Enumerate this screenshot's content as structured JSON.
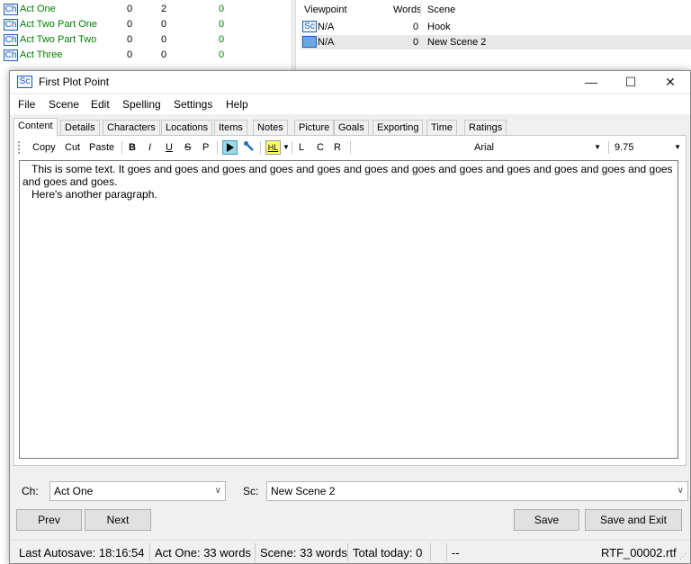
{
  "background": {
    "chapters": [
      {
        "badge": "Ch",
        "name": "Act One",
        "c1": "0",
        "c2": "2",
        "c3": "0"
      },
      {
        "badge": "Ch",
        "name": "Act Two Part One",
        "c1": "0",
        "c2": "0",
        "c3": "0"
      },
      {
        "badge": "Ch",
        "name": "Act Two Part Two",
        "c1": "0",
        "c2": "0",
        "c3": "0"
      },
      {
        "badge": "Ch",
        "name": "Act Three",
        "c1": "0",
        "c2": "0",
        "c3": "0"
      }
    ],
    "scenes_header": {
      "viewpoint": "Viewpoint",
      "words": "Words",
      "scene": "Scene"
    },
    "scenes": [
      {
        "badge": "Sc",
        "viewpoint": "N/A",
        "words": "0",
        "scene": "Hook"
      },
      {
        "badge": "",
        "viewpoint": "N/A",
        "words": "0",
        "scene": "New Scene 2"
      }
    ]
  },
  "dialog": {
    "icon": "Sc",
    "title": "First Plot Point",
    "window_buttons": {
      "minimize": "—",
      "maximize": "☐",
      "close": "✕"
    },
    "menu": [
      "File",
      "Scene",
      "Edit",
      "Spelling",
      "Settings",
      "Help"
    ],
    "tabs": [
      "Content",
      "Details",
      "Characters",
      "Locations",
      "Items",
      "Notes",
      "Picture",
      "Goals",
      "Exporting",
      "Time",
      "Ratings"
    ],
    "active_tab": "Content",
    "toolbar": {
      "copy": "Copy",
      "cut": "Cut",
      "paste": "Paste",
      "bold": "B",
      "italic": "I",
      "underline": "U",
      "strike": "S",
      "para": "P",
      "highlight": "HL",
      "left": "L",
      "center": "C",
      "right": "R",
      "font": "Arial",
      "size": "9.75"
    },
    "content": {
      "para1": "This is some text. It goes and goes and goes and goes and goes and goes and goes and goes and goes and goes and goes and goes and goes and goes.",
      "para2": "Here's another paragraph."
    },
    "chapter_label": "Ch:",
    "chapter_value": "Act One",
    "scene_label": "Sc:",
    "scene_value": "New Scene 2",
    "buttons": {
      "prev": "Prev",
      "next": "Next",
      "save": "Save",
      "save_exit": "Save and Exit"
    },
    "status": {
      "autosave": "Last Autosave: 18:16:54",
      "act_words": "Act One: 33 words",
      "scene_words": "Scene: 33 words",
      "total": "Total today: 0",
      "dash": "--",
      "file": "RTF_00002.rtf"
    }
  },
  "colors": {
    "chapter_text": "#008000",
    "badge_blue": "#1e5fb4",
    "play_button": "#99d9ea",
    "highlight_button": "#ffff66"
  }
}
